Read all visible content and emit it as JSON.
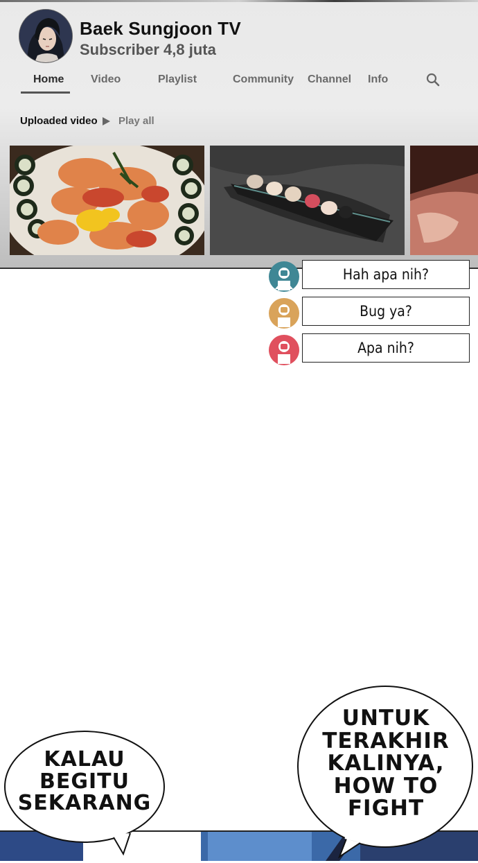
{
  "channel": {
    "name": "Baek Sungjoon TV",
    "subscribers": "Subscriber 4,8 juta"
  },
  "tabs": [
    {
      "label": "Home",
      "active": true
    },
    {
      "label": "Video"
    },
    {
      "label": "Playlist"
    },
    {
      "label": "Community"
    },
    {
      "label": "Channel"
    },
    {
      "label": "Info"
    }
  ],
  "search_icon": "search-icon",
  "uploads": {
    "title": "Uploaded video",
    "play_all": "Play all",
    "play_icon": "play-icon"
  },
  "comments": [
    {
      "text": "Hah apa nih?",
      "avatar_color": "#3f8795"
    },
    {
      "text": "Bug ya?",
      "avatar_color": "#d9a35a"
    },
    {
      "text": "Apa nih?",
      "avatar_color": "#e0505e"
    }
  ],
  "bubbles": {
    "left": [
      "KALAU",
      "BEGITU",
      "SEKARANG"
    ],
    "right": [
      "UNTUK",
      "TERAKHIR",
      "KALINYA,",
      "HOW TO",
      "FIGHT"
    ]
  }
}
